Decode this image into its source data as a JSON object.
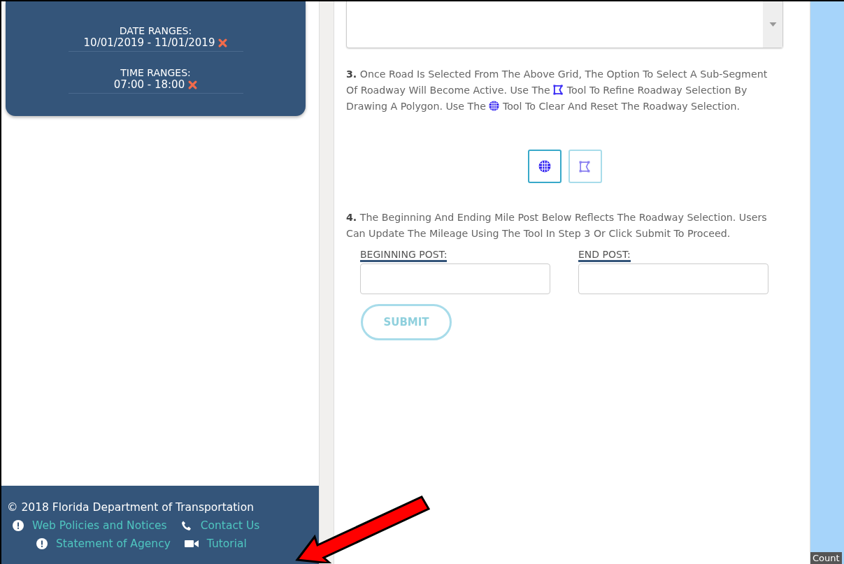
{
  "filters": [
    {
      "label": "DATE RANGES:",
      "value": "10/01/2019 - 11/01/2019"
    },
    {
      "label": "TIME RANGES:",
      "value": "07:00 - 18:00"
    }
  ],
  "step3": [
    {
      "kind": "text",
      "text": "**3.** Once Road Is Selected From The Above Grid, The Option To Select A Sub-Segment Of Roadway Will Become Active. Use The "
    },
    {
      "kind": "draw"
    },
    {
      "kind": "text",
      "text": " Tool To Refine Roadway Selection By Drawing A Polygon. Use The "
    },
    {
      "kind": "clear"
    },
    {
      "kind": "text",
      "text": " Tool To Clear And Reset The Roadway Selection."
    }
  ],
  "tools": [
    {
      "kind": "clear",
      "selected": true
    },
    {
      "kind": "draw",
      "selected": false
    }
  ],
  "step4": "**4.** The Beginning And Ending Mile Post Below Reflects The Roadway Selection. Users Can Update The Mileage Using The Tool In Step 3 Or Click Submit To Proceed.",
  "fields": [
    {
      "label": "BEGINNING POST:"
    },
    {
      "label": "END POST:"
    }
  ],
  "submit": {
    "label": "SUBMIT",
    "disabled": true
  },
  "footer": {
    "copyright": "© 2018 Florida Department of Transportation",
    "rows": [
      [
        {
          "kind": "info",
          "text": "Web Policies and Notices"
        },
        {
          "kind": "phone",
          "text": "Contact Us"
        }
      ],
      [
        {
          "kind": "info",
          "text": "Statement of Agency"
        },
        {
          "kind": "video",
          "text": "Tutorial"
        }
      ]
    ]
  },
  "map": {
    "attribution": "Count"
  }
}
